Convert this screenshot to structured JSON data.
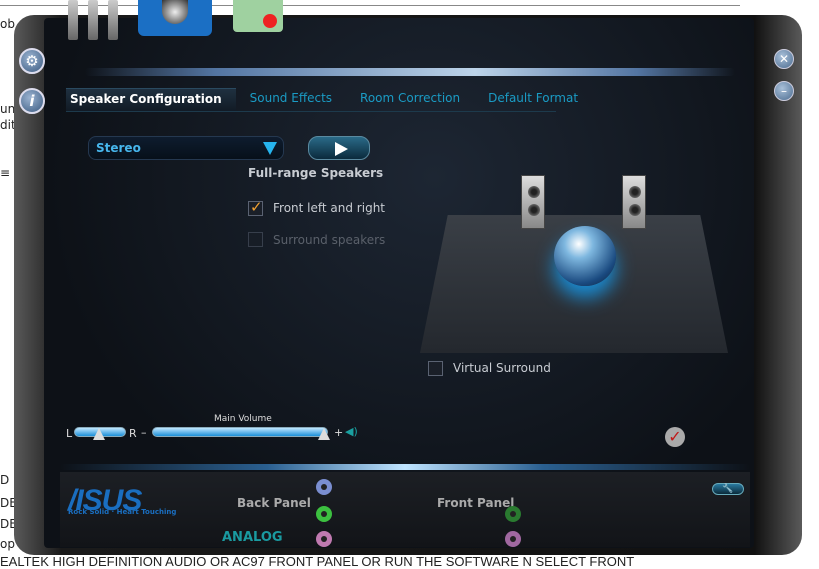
{
  "background": {
    "fragments": [
      "ob",
      "un",
      "dit",
      "≡",
      "D",
      "DE",
      "DE",
      "op"
    ],
    "bottom_text": "EALTEK HIGH DEFINITION AUDIO OR AC97 FRONT PANEL OR RUN THE SOFTWARE N SELECT FRONT"
  },
  "tabs": [
    {
      "label": "Speaker Configuration",
      "active": true
    },
    {
      "label": "Sound Effects"
    },
    {
      "label": "Room Correction"
    },
    {
      "label": "Default Format"
    }
  ],
  "speaker_config": {
    "selected": "Stereo",
    "section_title": "Full-range Speakers",
    "front_label": "Front left and right",
    "front_checked": true,
    "surround_label": "Surround speakers",
    "surround_checked": false,
    "virtual_surround_label": "Virtual Surround",
    "virtual_surround_checked": false
  },
  "volume": {
    "title": "Main Volume",
    "left_label": "L",
    "right_label": "R",
    "minus": "–",
    "plus": "+",
    "balance_percent": 50,
    "level_percent": 100
  },
  "footer": {
    "brand": "/ISUS",
    "tagline": "Rock Solid · Heart Touching",
    "back_panel": "Back Panel",
    "front_panel": "Front Panel",
    "analog": "ANALOG"
  },
  "colors": {
    "accent": "#1a9bc4",
    "brand": "#1a6ec0",
    "check": "#f0a030"
  }
}
